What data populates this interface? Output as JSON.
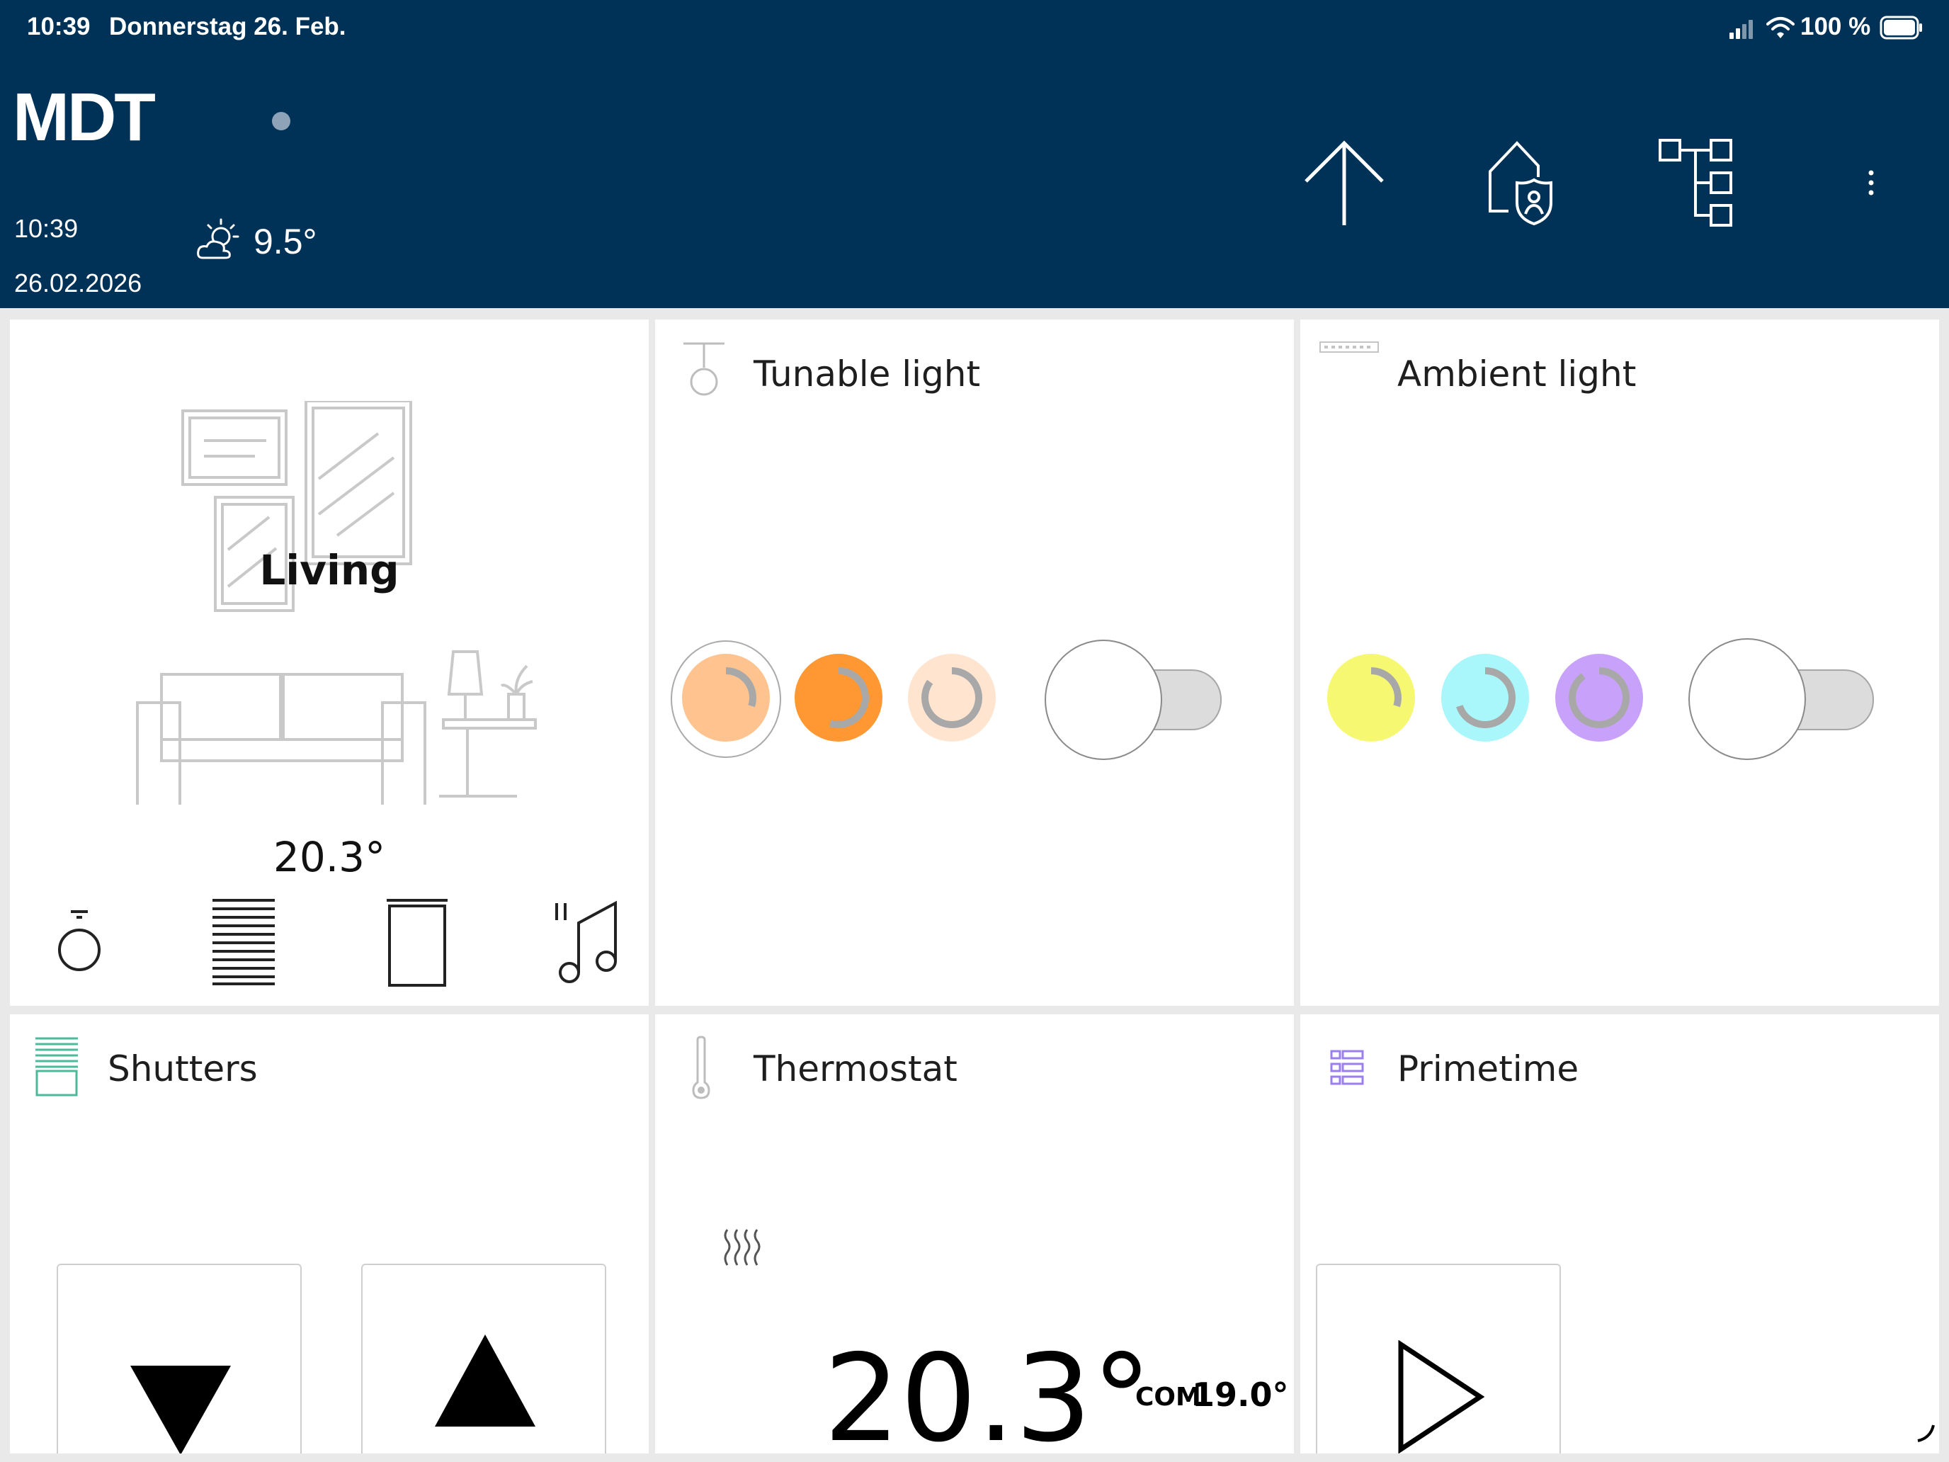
{
  "status_bar": {
    "time": "10:39",
    "date": "Donnerstag 26. Feb.",
    "battery": "100 %",
    "icons": [
      "signal-icon",
      "wifi-icon",
      "battery-icon"
    ]
  },
  "header": {
    "logo": "MDT",
    "time": "10:39",
    "date": "26.02.2026",
    "weather_temp": "9.5°",
    "weather_icon": "partly-cloudy-icon",
    "actions": [
      "arrow-up-icon",
      "home-security-icon",
      "structure-tree-icon",
      "more-vertical-icon"
    ]
  },
  "room": {
    "name": "Living",
    "temperature": "20.3°",
    "quick_icons": [
      "light-bulb-icon",
      "blinds-icon",
      "door-icon",
      "music-icon"
    ]
  },
  "tunable_light": {
    "title": "Tunable light",
    "icon": "pendant-lamp-icon",
    "swatches": [
      {
        "color": "#ffc38f",
        "level": 0.3
      },
      {
        "color": "#ff9832",
        "level": 0.55
      },
      {
        "color": "#ffe4d0",
        "level": 0.85
      }
    ],
    "switch_on": false
  },
  "ambient_light": {
    "title": "Ambient light",
    "icon": "led-strip-icon",
    "swatches": [
      {
        "color": "#f7f871",
        "level": 0.3
      },
      {
        "color": "#a9f7fb",
        "level": 0.7
      },
      {
        "color": "#c8a2fa",
        "level": 0.9
      }
    ],
    "switch_on": false
  },
  "shutters": {
    "title": "Shutters",
    "icon": "shutter-icon",
    "accent": "#4eb89a"
  },
  "thermostat": {
    "title": "Thermostat",
    "icon": "thermometer-icon",
    "current": "20.3°",
    "mode": "COM",
    "setpoint": "19.0°"
  },
  "primetime": {
    "title": "Primetime",
    "icon": "scene-list-icon",
    "accent": "#9b7ff0"
  },
  "colors": {
    "header_bg": "#003257",
    "background": "#e9e9e9",
    "tile_bg": "#ffffff"
  }
}
